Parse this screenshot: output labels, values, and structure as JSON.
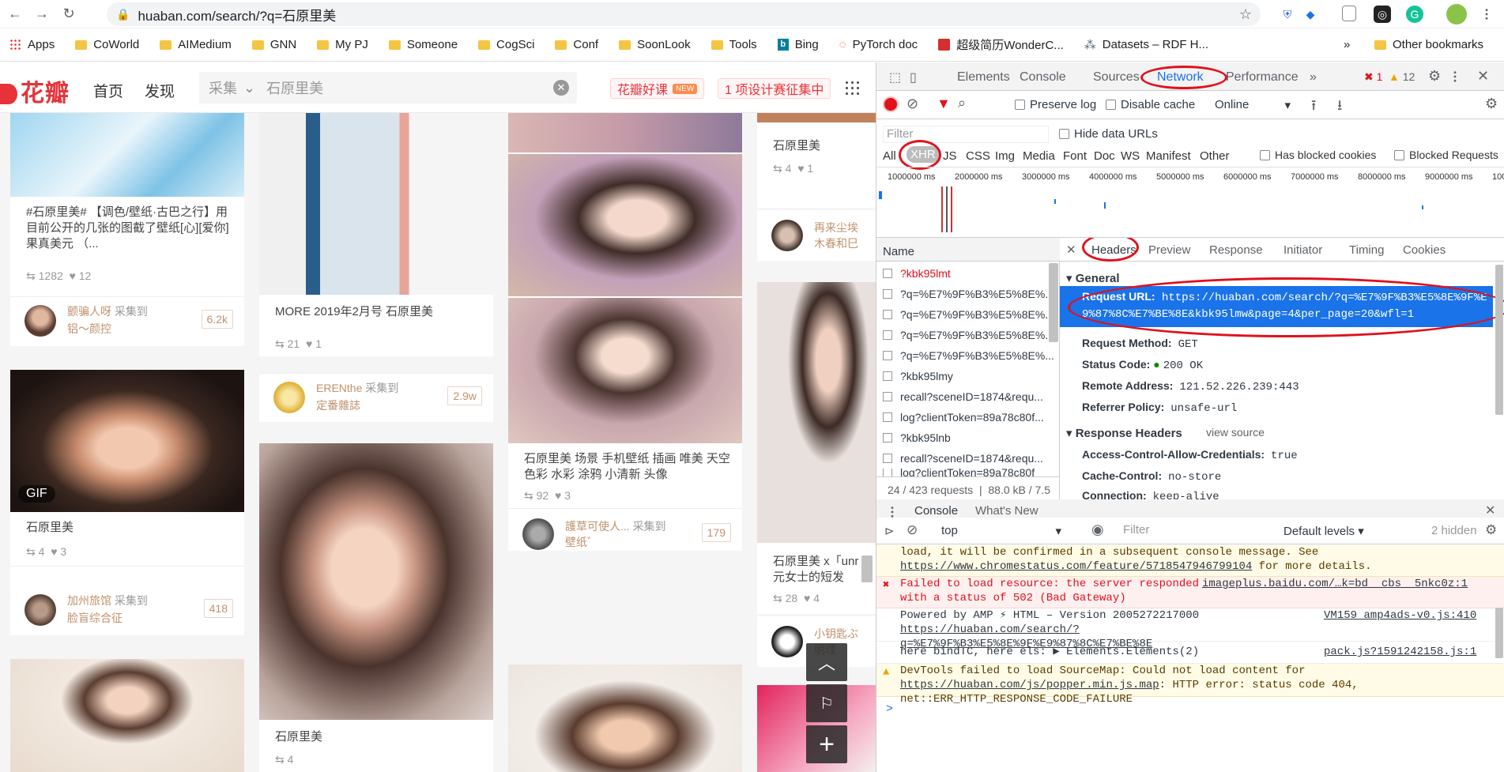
{
  "browser": {
    "url": "huaban.com/search/?q=石原里美",
    "bookmarks": [
      "Apps",
      "CoWorld",
      "AIMedium",
      "GNN",
      "My PJ",
      "Someone",
      "CogSci",
      "Conf",
      "SoonLook",
      "Tools",
      "Bing",
      "PyTorch doc",
      "超级简历WonderC...",
      "Datasets – RDF H..."
    ],
    "more": "»",
    "other_bookmarks": "Other bookmarks"
  },
  "site": {
    "logo": "花瓣",
    "nav": [
      "首页",
      "发现"
    ],
    "search_scope": "采集",
    "search_value": "石原里美",
    "promo1": "花瓣好课",
    "promo1_tag": "NEW",
    "promo2": "1 项设计赛征集中"
  },
  "cards": [
    {
      "title": "#石原里美# 【调色/壁纸·古巴之行】用目前公开的几张的图截了壁纸[心][爱你]果真美元 （...",
      "repins": "1282",
      "likes": "12",
      "user": "颤骗人呀",
      "collect": "采集到",
      "board": "铝～颜控",
      "count": "6.2k"
    },
    {
      "title": "石原里美",
      "repins": "4",
      "likes": "3",
      "user": "加州旅馆",
      "collect": "采集到",
      "board": "脸盲综合征",
      "count": "418",
      "gif": "GIF"
    },
    {
      "title": "MORE 2019年2月号 石原里美",
      "repins": "21",
      "likes": "1",
      "user": "ERENthe",
      "collect": "采集到",
      "board": "定番雜誌",
      "count": "2.9w"
    },
    {
      "title": "石原里美",
      "repins": "4"
    },
    {
      "title": "石原里美 场景 手机壁纸 插画 唯美 天空 色彩 水彩 涂鸦 小清新 头像",
      "repins": "92",
      "likes": "3",
      "user": "護草可使人...",
      "collect": "采集到",
      "board": "壁纸゛",
      "count": "179"
    },
    {
      "title": "石原里美",
      "repins": "4",
      "likes": "1"
    },
    {
      "user": "再来尘埃",
      "board": "木春和巳"
    },
    {
      "title": "石原里美 x「unr元女士的短发",
      "repins": "28",
      "likes": "4"
    },
    {
      "user": "小钥匙ぶ",
      "board": "明理"
    }
  ],
  "devtools": {
    "tabs": [
      "Elements",
      "Console",
      "Sources",
      "Network",
      "Performance",
      "»"
    ],
    "errors": "1",
    "warnings": "12",
    "preserve_log": "Preserve log",
    "disable_cache": "Disable cache",
    "throttle": "Online",
    "filter_placeholder": "Filter",
    "hide_data_urls": "Hide data URLs",
    "types": [
      "All",
      "XHR",
      "JS",
      "CSS",
      "Img",
      "Media",
      "Font",
      "Doc",
      "WS",
      "Manifest",
      "Other"
    ],
    "blocked_cookies": "Has blocked cookies",
    "blocked_requests": "Blocked Requests",
    "timeline": [
      "1000000 ms",
      "2000000 ms",
      "3000000 ms",
      "4000000 ms",
      "5000000 ms",
      "6000000 ms",
      "7000000 ms",
      "8000000 ms",
      "9000000 ms",
      "100"
    ],
    "name_header": "Name",
    "requests": [
      "?kbk95lmt",
      "?q=%E7%9F%B3%E5%8E%...",
      "?q=%E7%9F%B3%E5%8E%...",
      "?q=%E7%9F%B3%E5%8E%...",
      "?q=%E7%9F%B3%E5%8E%...",
      "?kbk95lmy",
      "recall?sceneID=1874&requ...",
      "log?clientToken=89a78c80f...",
      "?kbk95lnb",
      "recall?sceneID=1874&requ...",
      "log?clientToken=89a78c80f"
    ],
    "summary_requests": "24 / 423 requests",
    "summary_size": "88.0 kB / 7.5",
    "detail_tabs": [
      "Headers",
      "Preview",
      "Response",
      "Initiator",
      "Timing",
      "Cookies"
    ],
    "general": "General",
    "request_url_key": "Request URL:",
    "request_url": "https://huaban.com/search/?q=%E7%9F%B3%E5%8E%9F%E9%87%8C%E7%BE%8E&kbk95lmw&page=4&per_page=20&wfl=1",
    "request_url_line1": "https://huaban.com/search/?q=%E7%9F%B3%E5%8E%9F%E",
    "request_url_line2": "9%87%8C%E7%BE%8E&kbk95lmw&page=4&per_page=20&wfl=1",
    "method_key": "Request Method:",
    "method": "GET",
    "status_key": "Status Code:",
    "status": "200 OK",
    "remote_key": "Remote Address:",
    "remote": "121.52.226.239:443",
    "referrer_key": "Referrer Policy:",
    "referrer": "unsafe-url",
    "response_headers": "Response Headers",
    "view_source": "view source",
    "acac_key": "Access-Control-Allow-Credentials:",
    "acac": "true",
    "cache_key": "Cache-Control:",
    "cache": "no-store",
    "conn_key": "Connection:",
    "conn": "keep-alive",
    "drawer_tabs": [
      "Console",
      "What's New"
    ],
    "context": "top",
    "console_filter": "Filter",
    "levels": "Default levels",
    "hidden": "2 hidden",
    "log1a": "load, it will be confirmed in a subsequent console message. See ",
    "log1_link": "https://www.chromestatus.com/feature/5718547946799104",
    "log1b": " for more details.",
    "log2": "Failed to load resource: the server responded with a status of 502 (Bad Gateway)",
    "log2_src": "imageplus.baidu.com/…k=bd__cbs__5nkc0z:1",
    "log3a": "Powered by AMP ⚡ HTML – Version 2005272217000 ",
    "log3_link": "https://huaban.com/search/?q=%E7%9F%B3%E5%8E%9F%E9%87%8C%E7%BE%8E",
    "log3_src": "VM159 amp4ads-v0.js:410",
    "log4": "here bindTC, here els:",
    "log4_obj": "▶ Elements.Elements(2)",
    "log4_src": "pack.js?1591242158.js:1",
    "log5a": "DevTools failed to load SourceMap: Could not load content for ",
    "log5_link": "https://huaban.com/js/popper.min.js.map",
    "log5b": ": HTTP error: status code 404, net::ERR_HTTP_RESPONSE_CODE_FAILURE",
    "prompt": ">"
  },
  "colors": {
    "accent": "#e6333a",
    "devtools_blue": "#1a73e8",
    "highlight": "#e0111c"
  }
}
